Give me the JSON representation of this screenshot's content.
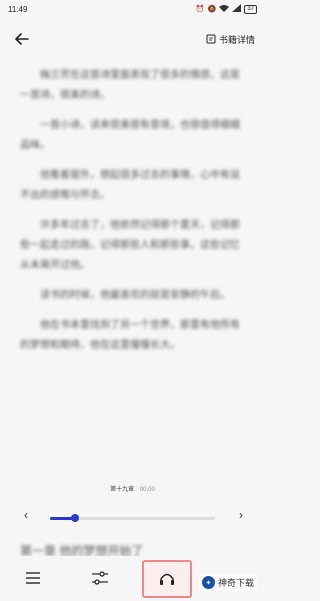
{
  "status": {
    "time": "11:49",
    "battery": "37"
  },
  "header": {
    "book_detail_label": "书籍详情"
  },
  "reader": {
    "paragraphs": [
      "梅兰芳在这首诗里面表现了很多的情感，这是一首诗，很美的诗。",
      "一首小诗，读来很美很有意境，也很值得细细品味。",
      "他看着窗外，想起很多过去的事情，心中有说不出的感慨与怀念。",
      "许多年过去了，他依然记得那个夏天，记得那些一起走过的路，记得那些人和那些事，这些记忆从未离开过他。",
      "读书的时候，他最喜欢的就是安静的午后。",
      "他在书本里找到了另一个世界，那里有他所有的梦想和期待，他在这里慢慢长大。"
    ],
    "next_line": "第一章 他的梦想开始了"
  },
  "progress": {
    "chapter_label": "第十九章",
    "percent_label": "00.00",
    "value": 0.15
  },
  "watermark": {
    "text": "神奇下载"
  }
}
